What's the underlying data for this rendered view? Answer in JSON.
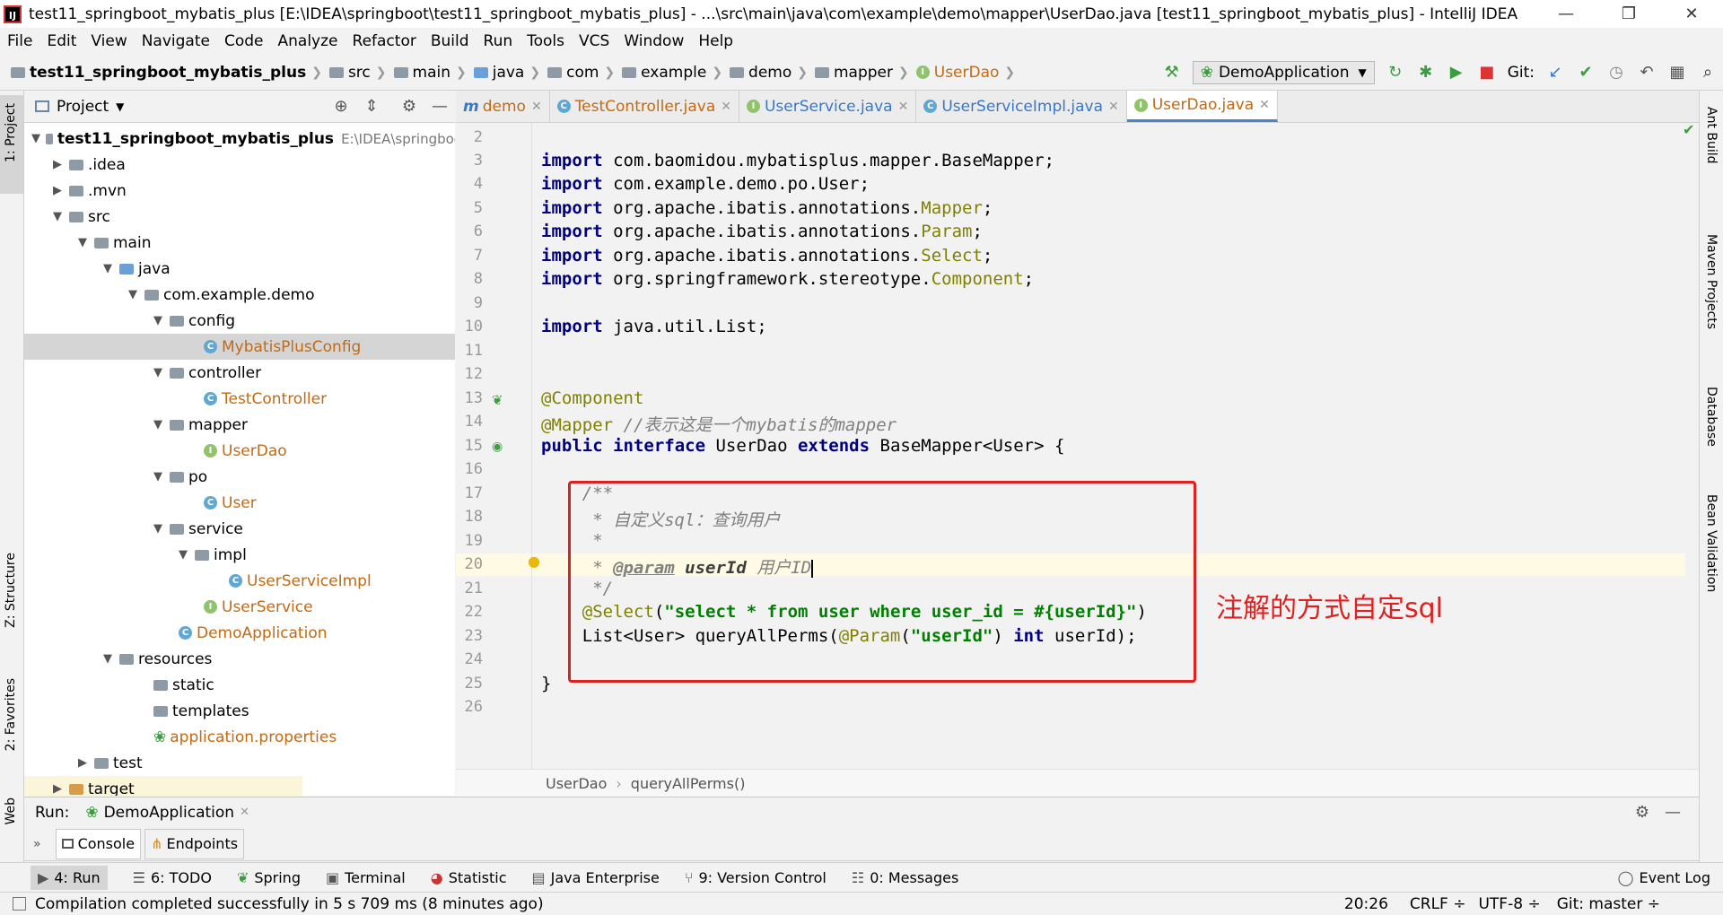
{
  "window": {
    "title": "test11_springboot_mybatis_plus [E:\\IDEA\\springboot\\test11_springboot_mybatis_plus] - ...\\src\\main\\java\\com\\example\\demo\\mapper\\UserDao.java [test11_springboot_mybatis_plus] - IntelliJ IDEA",
    "minimize": "—",
    "maximize": "❐",
    "close": "✕"
  },
  "menu": [
    "File",
    "Edit",
    "View",
    "Navigate",
    "Code",
    "Analyze",
    "Refactor",
    "Build",
    "Run",
    "Tools",
    "VCS",
    "Window",
    "Help"
  ],
  "breadcrumbs": [
    "test11_springboot_mybatis_plus",
    "src",
    "main",
    "java",
    "com",
    "example",
    "demo",
    "mapper",
    "UserDao"
  ],
  "toolbar": {
    "run_config": "DemoApplication",
    "git_label": "Git:"
  },
  "left_stripe": {
    "project": "1: Project",
    "structure": "Z: Structure",
    "favorites": "2: Favorites",
    "web": "Web"
  },
  "right_stripe": {
    "ant": "Ant Build",
    "maven": "Maven Projects",
    "database": "Database",
    "bean": "Bean Validation"
  },
  "project_panel": {
    "title": "Project",
    "root_name": "test11_springboot_mybatis_plus",
    "root_path": "E:\\IDEA\\springboo",
    "tree": [
      {
        "label": ".idea"
      },
      {
        "label": ".mvn"
      },
      {
        "label": "src"
      },
      {
        "label": "main"
      },
      {
        "label": "java"
      },
      {
        "label": "com.example.demo"
      },
      {
        "label": "config"
      },
      {
        "label": "MybatisPlusConfig"
      },
      {
        "label": "controller"
      },
      {
        "label": "TestController"
      },
      {
        "label": "mapper"
      },
      {
        "label": "UserDao"
      },
      {
        "label": "po"
      },
      {
        "label": "User"
      },
      {
        "label": "service"
      },
      {
        "label": "impl"
      },
      {
        "label": "UserServiceImpl"
      },
      {
        "label": "UserService"
      },
      {
        "label": "DemoApplication"
      },
      {
        "label": "resources"
      },
      {
        "label": "static"
      },
      {
        "label": "templates"
      },
      {
        "label": "application.properties"
      },
      {
        "label": "test"
      },
      {
        "label": "target"
      }
    ]
  },
  "editor_tabs": [
    {
      "label": "demo"
    },
    {
      "label": "TestController.java"
    },
    {
      "label": "UserService.java"
    },
    {
      "label": "UserServiceImpl.java"
    },
    {
      "label": "UserDao.java"
    }
  ],
  "line_numbers": [
    "2",
    "3",
    "4",
    "5",
    "6",
    "7",
    "8",
    "9",
    "10",
    "11",
    "12",
    "13",
    "14",
    "15",
    "16",
    "17",
    "18",
    "19",
    "20",
    "21",
    "22",
    "23",
    "24",
    "25",
    "26"
  ],
  "code": {
    "l3_kw": "import",
    "l3_rest": " com.baomidou.mybatisplus.mapper.BaseMapper;",
    "l4_kw": "import",
    "l4_rest": " com.example.demo.po.User;",
    "l5_kw": "import",
    "l5_rest": " org.apache.ibatis.annotations.",
    "l5_ann": "Mapper",
    "l5_end": ";",
    "l6_kw": "import",
    "l6_rest": " org.apache.ibatis.annotations.",
    "l6_ann": "Param",
    "l6_end": ";",
    "l7_kw": "import",
    "l7_rest": " org.apache.ibatis.annotations.",
    "l7_ann": "Select",
    "l7_end": ";",
    "l8_kw": "import",
    "l8_rest": " org.springframework.stereotype.",
    "l8_ann": "Component",
    "l8_end": ";",
    "l10_kw": "import",
    "l10_rest": " java.util.List;",
    "l13_ann": "@Component",
    "l14_ann": "@Mapper",
    "l14_cm": " //表示这是一个mybatis的mapper",
    "l15_kw1": "public interface",
    "l15_mid": " UserDao ",
    "l15_kw2": "extends",
    "l15_rest": " BaseMapper<User> {",
    "l17_cm": "    /**",
    "l18_cm": "     * 自定义sql：查询用户",
    "l19_cm": "     *",
    "l20_pre": "     * ",
    "l20_tag": "@param",
    "l20_param": " userId",
    "l20_desc": " 用户ID",
    "l21_cm": "     */",
    "l22_pre": "    ",
    "l22_ann": "@Select",
    "l22_p1": "(",
    "l22_str": "\"select * from user where user_id = #{userId}\"",
    "l22_p2": ")",
    "l23_pre": "    List<User> queryAllPerms(",
    "l23_ann": "@Param",
    "l23_p1": "(",
    "l23_str": "\"userId\"",
    "l23_p2": ") ",
    "l23_kw": "int",
    "l23_end": " userId);",
    "l25": "}"
  },
  "annotation_text": "注解的方式自定sql",
  "editor_breadcrumb": [
    "UserDao",
    "queryAllPerms()"
  ],
  "run_panel": {
    "label": "Run:",
    "config": "DemoApplication",
    "tabs": [
      "Console",
      "Endpoints"
    ]
  },
  "tool_windows": [
    "4: Run",
    "6: TODO",
    "Spring",
    "Terminal",
    "Statistic",
    "Java Enterprise",
    "9: Version Control",
    "0: Messages",
    "Event Log"
  ],
  "status": {
    "message": "Compilation completed successfully in 5 s 709 ms (8 minutes ago)",
    "position": "20:26",
    "line_sep": "CRLF ÷",
    "encoding": "UTF-8 ÷",
    "git": "Git: master ÷"
  }
}
